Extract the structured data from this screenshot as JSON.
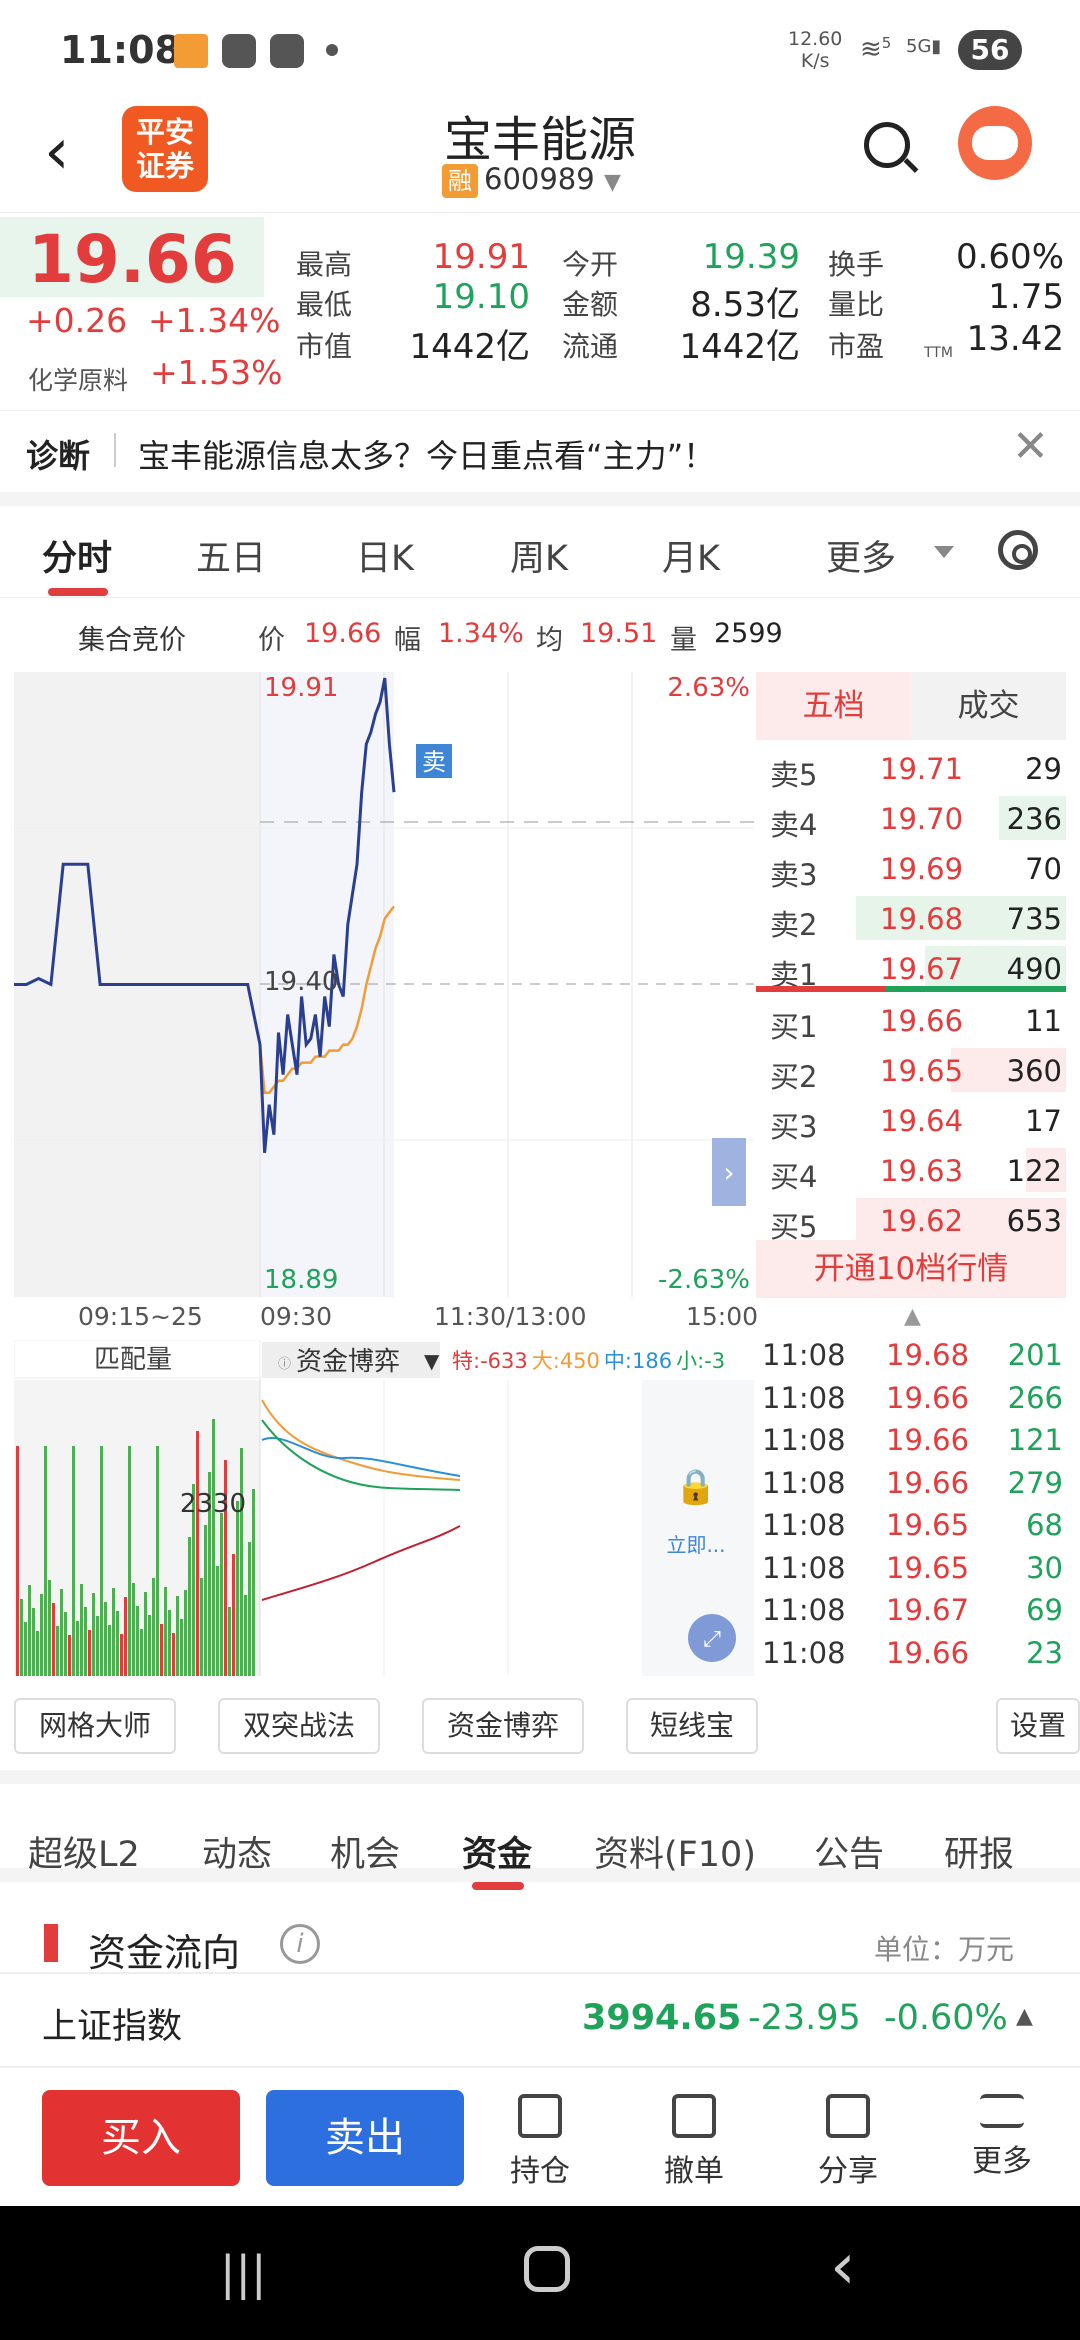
{
  "status": {
    "time": "11:08",
    "net_speed_top": "12.60",
    "net_speed_bottom": "K/s",
    "signal_a": "5",
    "signal_b": "5G",
    "battery": "56"
  },
  "header": {
    "title": "宝丰能源",
    "badge": "融",
    "code": "600989",
    "logo_line1": "平安",
    "logo_line2": "证券"
  },
  "quote": {
    "price": "19.66",
    "change": "+0.26",
    "change_pct": "+1.34%",
    "industry": "化学原料",
    "industry_pct": "+1.53%",
    "stats": [
      {
        "label": "最高",
        "value": "19.91",
        "color": "red"
      },
      {
        "label": "今开",
        "value": "19.39",
        "color": "green"
      },
      {
        "label": "换手",
        "value": "0.60%",
        "color": "dark"
      },
      {
        "label": "最低",
        "value": "19.10",
        "color": "green"
      },
      {
        "label": "金额",
        "value": "8.53亿",
        "color": "dark"
      },
      {
        "label": "量比",
        "value": "1.75",
        "color": "dark"
      },
      {
        "label": "市值",
        "value": "1442亿",
        "color": "dark"
      },
      {
        "label": "流通",
        "value": "1442亿",
        "color": "dark"
      },
      {
        "label": "市盈",
        "value": "13.42",
        "color": "dark"
      }
    ],
    "ttm": "TTM"
  },
  "diag": {
    "label": "诊断",
    "text": "宝丰能源信息太多？今日重点看“主力”！"
  },
  "chart_tabs": [
    "分时",
    "五日",
    "日K",
    "周K",
    "月K",
    "更多"
  ],
  "info": {
    "auction": "集合竞价",
    "price_label": "价",
    "price": "19.66",
    "amp_label": "幅",
    "amp": "1.34%",
    "avg_label": "均",
    "avg": "19.51",
    "vol_label": "量",
    "vol": "2599"
  },
  "chart_data": {
    "type": "line",
    "title": "",
    "ylim": [
      18.89,
      19.91
    ],
    "y_labels": {
      "top": "19.91",
      "mid": "19.40",
      "bottom": "18.89",
      "top_pct": "2.63%",
      "bottom_pct": "-2.63%"
    },
    "x_labels": [
      "09:15~25",
      "09:30",
      "11:30/13:00",
      "15:00"
    ],
    "sell_marker": "卖",
    "series": [
      {
        "name": "价",
        "values": [
          19.4,
          19.4,
          19.41,
          19.4,
          19.6,
          19.6,
          19.6,
          19.4,
          19.4,
          19.4,
          19.4,
          19.4,
          19.4,
          19.4,
          19.4,
          19.4,
          19.4,
          19.4,
          19.4,
          19.4,
          19.3,
          19.12,
          19.2,
          19.15,
          19.32,
          19.25,
          19.35,
          19.3,
          19.25,
          19.38,
          19.3,
          19.31,
          19.35,
          19.28,
          19.38,
          19.33,
          19.45,
          19.4,
          19.38,
          19.5,
          19.55,
          19.6,
          19.72,
          19.8,
          19.82,
          19.85,
          19.87,
          19.91,
          19.8,
          19.72
        ]
      },
      {
        "name": "均",
        "values": [
          null,
          null,
          null,
          null,
          null,
          null,
          null,
          null,
          null,
          null,
          null,
          null,
          null,
          null,
          null,
          null,
          null,
          null,
          null,
          null,
          19.3,
          19.22,
          19.22,
          19.23,
          19.24,
          19.24,
          19.25,
          19.26,
          19.26,
          19.27,
          19.27,
          19.27,
          19.28,
          19.28,
          19.28,
          19.29,
          19.29,
          19.29,
          19.3,
          19.3,
          19.31,
          19.33,
          19.36,
          19.4,
          19.43,
          19.46,
          19.48,
          19.51,
          19.52,
          19.53
        ]
      }
    ]
  },
  "sub_chart": {
    "tab_left": "匹配量",
    "tab_mid": "资金博弈",
    "legend": [
      {
        "k": "特:-633",
        "c": "#e23c3c"
      },
      {
        "k": "大:450",
        "c": "#f39b35"
      },
      {
        "k": "中:186",
        "c": "#2b8fd6"
      },
      {
        "k": "小:-3",
        "c": "#1fa25a"
      }
    ],
    "value": "2330",
    "lock_text": "立即..."
  },
  "book": {
    "tab_active": "五档",
    "tab_other": "成交",
    "asks": [
      {
        "l": "卖5",
        "p": "19.71",
        "v": "29",
        "bar": 0
      },
      {
        "l": "卖4",
        "p": "19.70",
        "v": "236",
        "bar": 0.32
      },
      {
        "l": "卖3",
        "p": "19.69",
        "v": "70",
        "bar": 0
      },
      {
        "l": "卖2",
        "p": "19.68",
        "v": "735",
        "bar": 1
      },
      {
        "l": "卖1",
        "p": "19.67",
        "v": "490",
        "bar": 0.67
      }
    ],
    "bids": [
      {
        "l": "买1",
        "p": "19.66",
        "v": "11",
        "bar": 0
      },
      {
        "l": "买2",
        "p": "19.65",
        "v": "360",
        "bar": 0.55
      },
      {
        "l": "买3",
        "p": "19.64",
        "v": "17",
        "bar": 0
      },
      {
        "l": "买4",
        "p": "19.63",
        "v": "122",
        "bar": 0.19
      },
      {
        "l": "买5",
        "p": "19.62",
        "v": "653",
        "bar": 1
      }
    ],
    "open10": "开通10档行情"
  },
  "ticks": [
    {
      "t": "11:08",
      "p": "19.68",
      "v": "201"
    },
    {
      "t": "11:08",
      "p": "19.66",
      "v": "266"
    },
    {
      "t": "11:08",
      "p": "19.66",
      "v": "121"
    },
    {
      "t": "11:08",
      "p": "19.66",
      "v": "279"
    },
    {
      "t": "11:08",
      "p": "19.65",
      "v": "68"
    },
    {
      "t": "11:08",
      "p": "19.65",
      "v": "30"
    },
    {
      "t": "11:08",
      "p": "19.67",
      "v": "69"
    },
    {
      "t": "11:08",
      "p": "19.66",
      "v": "23"
    }
  ],
  "tools": [
    "网格大师",
    "双突战法",
    "资金博弈",
    "短线宝",
    "设置"
  ],
  "bottom_tabs": [
    "超级L2",
    "动态",
    "机会",
    "资金",
    "资料(F10)",
    "公告",
    "研报"
  ],
  "flow": {
    "title": "资金流向",
    "unit": "单位：万元"
  },
  "index": {
    "name": "上证指数",
    "value": "3994.65",
    "change": "-23.95",
    "pct": "-0.60%"
  },
  "actions": {
    "buy": "买入",
    "sell": "卖出",
    "items": [
      "持仓",
      "撤单",
      "分享",
      "更多"
    ]
  }
}
